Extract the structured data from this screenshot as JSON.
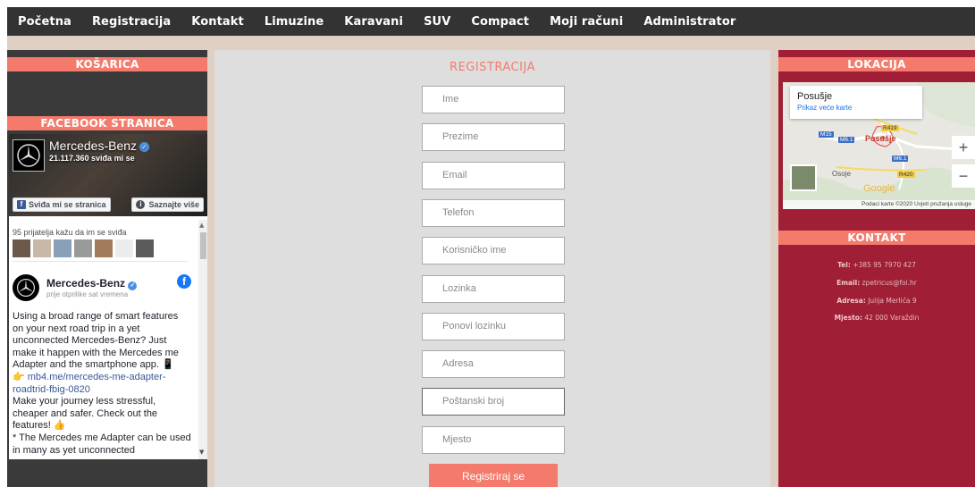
{
  "nav": {
    "items": [
      "Početna",
      "Registracija",
      "Kontakt",
      "Limuzine",
      "Karavani",
      "SUV",
      "Compact",
      "Moji računi",
      "Administrator"
    ]
  },
  "left": {
    "cart_title": "KOŠARICA",
    "facebook_title": "FACEBOOK STRANICA",
    "fb": {
      "page_name": "Mercedes-Benz",
      "likes": "21.117.360 sviđa mi se",
      "like_button": "Sviđa mi se stranica",
      "more_button": "Saznajte više",
      "friends_text": "95 prijatelja kažu da im se sviđa",
      "post_name": "Mercedes-Benz",
      "post_time": "prije otprilike sat vremena",
      "post_text_1": "Using a broad range of smart features on your next road trip in a yet unconnected Mercedes-Benz? Just make it happen with the Mercedes me Adapter and the smartphone app. 📱\n👉 ",
      "post_link": "mb4.me/mercedes-me-adapter-roadtrid-fbig-0820",
      "post_text_2": "\nMake your journey less stressful, cheaper and safer. Check out the features! 👍\n* The Mercedes me Adapter can be used in many as yet unconnected"
    }
  },
  "form": {
    "title": "REGISTRACIJA",
    "fields": [
      "Ime",
      "Prezime",
      "Email",
      "Telefon",
      "Korisničko ime",
      "Lozinka",
      "Ponovi lozinku",
      "Adresa",
      "Poštanski broj",
      "Mjesto"
    ],
    "submit": "Registriraj se"
  },
  "right": {
    "location_title": "LOKACIJA",
    "map": {
      "place": "Posušje",
      "link": "Prikaz veće karte",
      "town_label": "Posušje",
      "village_label": "Osoje",
      "road_labels": [
        "R419",
        "M15",
        "M6.1",
        "M6.1",
        "R420"
      ],
      "google": "Google",
      "footer": "Podaci karte ©2020   Uvjeti pružanja usluge"
    },
    "contact_title": "KONTAKT",
    "contact": {
      "tel_label": "Tel:",
      "tel": "+385 95 7970 427",
      "email_label": "Email:",
      "email": "zpetricus@foi.hr",
      "address_label": "Adresa:",
      "address": "Julija Merlića 9",
      "city_label": "Mjesto:",
      "city": "42 000 Varaždin"
    }
  },
  "colors": {
    "accent": "#f47b6b",
    "nav_bg": "#333333",
    "right_bg": "#a01f36",
    "center_bg": "#dedede"
  }
}
